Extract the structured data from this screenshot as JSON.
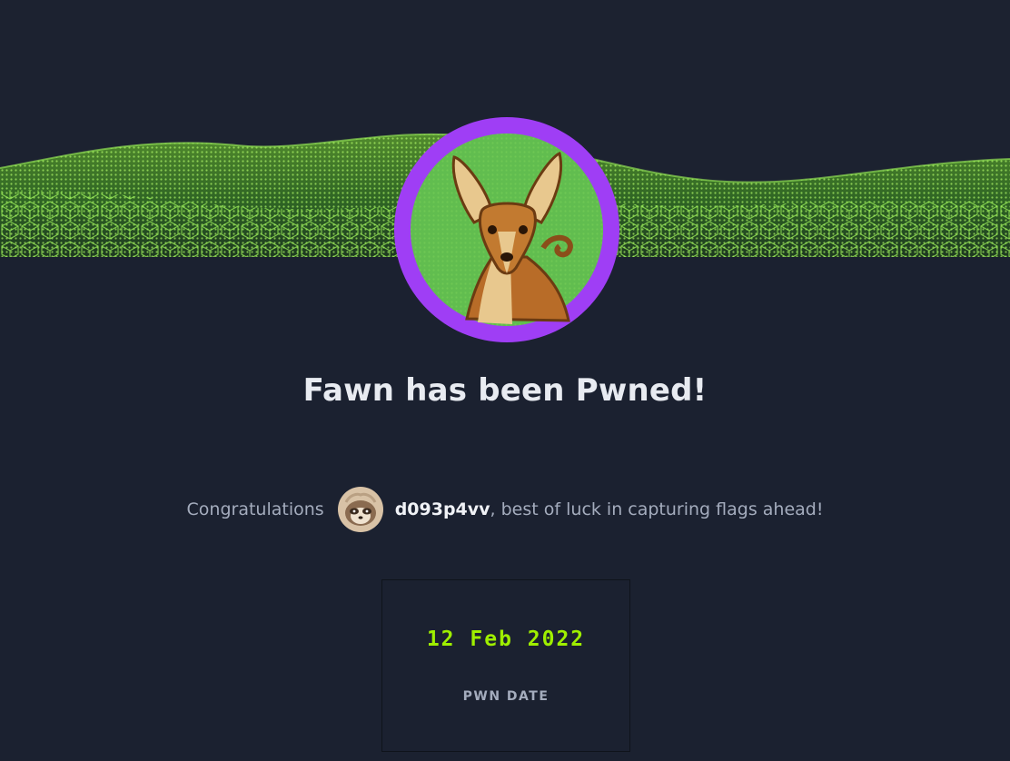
{
  "machine": {
    "name": "Fawn",
    "avatar_icon": "fawn-deer-icon",
    "ring_color": "#9f3ef5"
  },
  "headline": "Fawn has been Pwned!",
  "congrats": {
    "prefix": "Congratulations",
    "username": "d093p4vv",
    "suffix": ", best of luck in capturing flags ahead!",
    "avatar_icon": "user-avatar-icon"
  },
  "stat": {
    "value": "12 Feb 2022",
    "label": "PWN DATE"
  },
  "colors": {
    "background": "#1b2130",
    "accent_green": "#9fef00",
    "text_muted": "#a4acbd"
  }
}
